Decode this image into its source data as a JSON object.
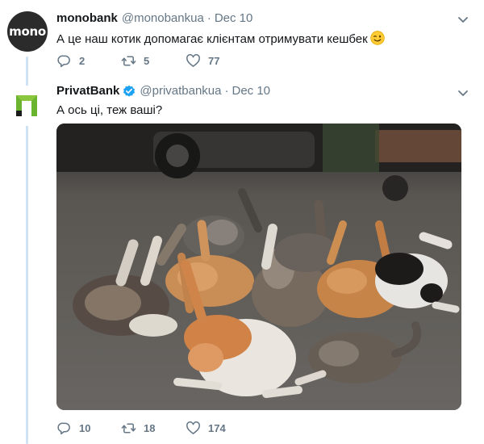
{
  "tweets": [
    {
      "name": "monobank",
      "handle": "@monobankua",
      "date": "Dec 10",
      "avatar_text": "mono",
      "text": "А це наш котик допомагає клієнтам отримувати кешбек",
      "emoji": "winking-face",
      "replies": "2",
      "retweets": "5",
      "likes": "77"
    },
    {
      "name": "PrivatBank",
      "verified": true,
      "handle": "@privatbankua",
      "date": "Dec 10",
      "text": "А ось ці, теж ваші?",
      "image": "photo of a group of cats lying on an asphalt road",
      "replies": "10",
      "retweets": "18",
      "likes": "174"
    }
  ],
  "colors": {
    "meta_grey": "#657786",
    "verified_blue": "#1da1f2",
    "thread_line": "#cfe3f5",
    "privat_green": "#6bb430"
  },
  "icons": [
    "reply-icon",
    "retweet-icon",
    "like-icon",
    "chevron-down-icon",
    "verified-badge-icon"
  ]
}
